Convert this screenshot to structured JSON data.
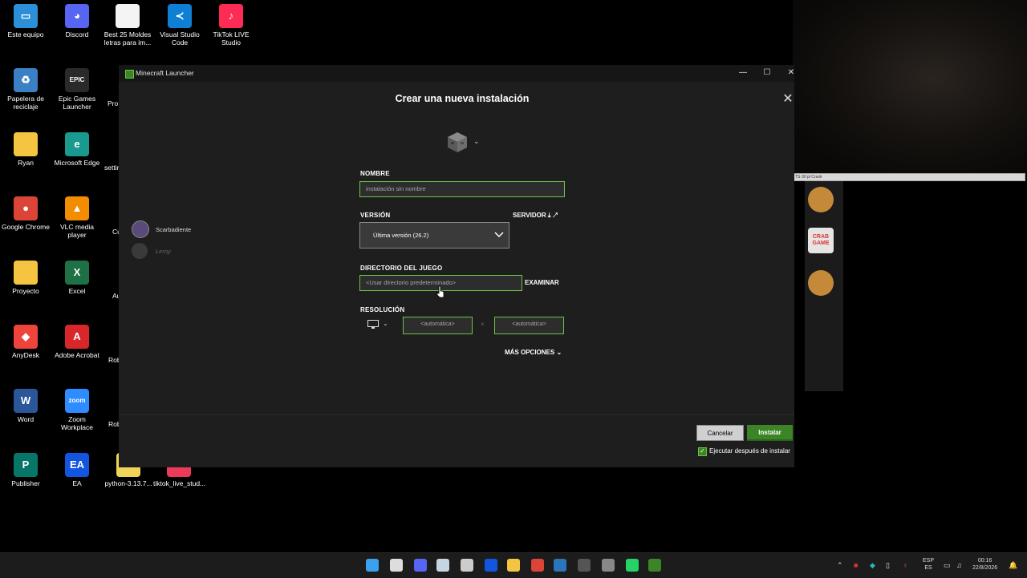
{
  "desktop": {
    "icons": [
      {
        "label": "Este equipo",
        "glyph": "▭",
        "color": "#2c8fd8"
      },
      {
        "label": "Discord",
        "glyph": "◕",
        "color": "#5865f2"
      },
      {
        "label": "Best 25 Moldes letras para im...",
        "glyph": "",
        "color": "#f4f4f4"
      },
      {
        "label": "Visual Studio Code",
        "glyph": "≺",
        "color": "#0f7fd4"
      },
      {
        "label": "TikTok LIVE Studio",
        "glyph": "♪",
        "color": "#fe2c55"
      },
      {
        "label": "Papelera de reciclaje",
        "glyph": "♻",
        "color": "#3b7fc4"
      },
      {
        "label": "Epic Games Launcher",
        "glyph": "EPIC",
        "color": "#2a2a2a"
      },
      {
        "label": "Ryan",
        "glyph": "",
        "color": "#f5c542"
      },
      {
        "label": "Microsoft Edge",
        "glyph": "e",
        "color": "#1a9a8e"
      },
      {
        "label": "Google Chrome",
        "glyph": "●",
        "color": "#db4437"
      },
      {
        "label": "VLC media player",
        "glyph": "▲",
        "color": "#f28c00"
      },
      {
        "label": "Proyecto",
        "glyph": "",
        "color": "#f5c542"
      },
      {
        "label": "Excel",
        "glyph": "X",
        "color": "#1e7145"
      },
      {
        "label": "AnyDesk",
        "glyph": "◆",
        "color": "#ef443b"
      },
      {
        "label": "Adobe Acrobat",
        "glyph": "A",
        "color": "#d8262b"
      },
      {
        "label": "Word",
        "glyph": "W",
        "color": "#2b579a"
      },
      {
        "label": "Zoom Workplace",
        "glyph": "zoom",
        "color": "#2d8cff"
      },
      {
        "label": "Publisher",
        "glyph": "P",
        "color": "#077568"
      },
      {
        "label": "EA",
        "glyph": "EA",
        "color": "#1256e0"
      },
      {
        "label": "python-3.13.7...",
        "glyph": "",
        "color": "#f0d45a"
      },
      {
        "label": "tiktok_live_stud...",
        "glyph": "",
        "color": "#ee3a5a"
      }
    ],
    "partial_labels": [
      "Pro S",
      "settin",
      "Cu",
      "Au",
      "Rob",
      "Rob"
    ]
  },
  "webcam": {
    "strip_text": "TS·30 pl Crank"
  },
  "side_apps": [
    {
      "name": "avatar-1",
      "text": "",
      "color": "#c48a3a"
    },
    {
      "name": "crab-game",
      "text": "CRAB GAME",
      "color": "#e5e5e5"
    },
    {
      "name": "avatar-2",
      "text": "",
      "color": "#c48a3a"
    }
  ],
  "launcher": {
    "window_title": "Minecraft Launcher",
    "controls": {
      "minimize": "—",
      "maximize": "☐",
      "close": "✕"
    },
    "dialog_title": "Crear una nueva instalación",
    "name_label": "NOMBRE",
    "name_placeholder": "instalación sin nombre",
    "version_label": "VERSIÓN",
    "version_value": "Última versión (26.2)",
    "server_link": "SERVIDOR",
    "game_dir_label": "DIRECTORIO DEL JUEGO",
    "game_dir_placeholder": "<Usar directorio predeterminado>",
    "browse_button": "EXAMINAR",
    "resolution_label": "RESOLUCIÓN",
    "res_width": "<automática>",
    "res_separator": "×",
    "res_height": "<automática>",
    "more_options": "MÁS OPCIONES",
    "cancel_button": "Cancelar",
    "install_button": "Instalar",
    "run_after_install": "Ejecutar después de instalar",
    "run_after_checked": true,
    "friends": [
      {
        "name": "Scarbadiente"
      },
      {
        "name": "Leroy"
      }
    ],
    "accent": "#3c8527"
  },
  "taskbar": {
    "lang_line1": "ESP",
    "lang_line2": "ES",
    "time": "00:16",
    "date": "22/8/2026",
    "apps": [
      {
        "name": "start-icon",
        "color": "#3aa0f0"
      },
      {
        "name": "search-icon",
        "color": "#dddddd"
      },
      {
        "name": "discord-icon",
        "color": "#5865f2"
      },
      {
        "name": "steam-icon",
        "color": "#c7d5e0"
      },
      {
        "name": "epic-icon",
        "color": "#cccccc"
      },
      {
        "name": "ea-icon",
        "color": "#1256e0"
      },
      {
        "name": "explorer-icon",
        "color": "#f5c542"
      },
      {
        "name": "chrome-icon",
        "color": "#db4437"
      },
      {
        "name": "steam-alt-icon",
        "color": "#2a75bb"
      },
      {
        "name": "terminal-icon",
        "color": "#555555"
      },
      {
        "name": "obs-icon",
        "color": "#888888"
      },
      {
        "name": "whatsapp-icon",
        "color": "#25d366"
      },
      {
        "name": "minecraft-icon",
        "color": "#3c8527"
      }
    ]
  }
}
